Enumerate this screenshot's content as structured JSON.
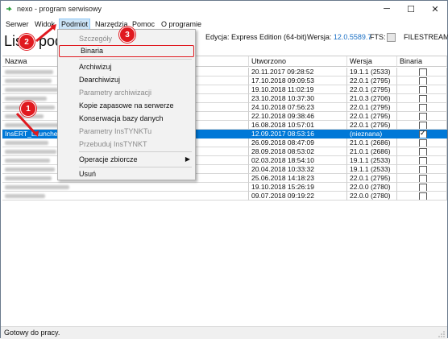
{
  "window": {
    "title": "nexo - program serwisowy",
    "controls": {
      "minimize": "─",
      "maximize": "☐",
      "close": "✕"
    }
  },
  "menu": [
    "Serwer",
    "Widok",
    "Podmiot",
    "Narzędzia",
    "Pomoc",
    "O programie"
  ],
  "heading": "Lista podmiotów",
  "info": {
    "edition_label": "Edycja:",
    "edition_value": "Express Edition (64-bit)",
    "version_label": "Wersja:",
    "version_value": "12.0.5589.7",
    "fts_label": "FTS:",
    "filestream_label": "FILESTREAM:"
  },
  "grid": {
    "columns": [
      "Nazwa",
      "Utworzono",
      "Wersja",
      "Binaria"
    ],
    "rows": [
      {
        "name": "",
        "created": "20.11.2017 09:28:52",
        "version": "19.1.1 (2533)",
        "binaria": false
      },
      {
        "name": "",
        "created": "17.10.2018 09:09:53",
        "version": "22.0.1 (2795)",
        "binaria": false
      },
      {
        "name": "",
        "created": "19.10.2018 11:02:19",
        "version": "22.0.1 (2795)",
        "binaria": false
      },
      {
        "name": "",
        "created": "23.10.2018 10:37:30",
        "version": "21.0.3 (2706)",
        "binaria": false
      },
      {
        "name": "",
        "created": "24.10.2018 07:56:23",
        "version": "22.0.1 (2795)",
        "binaria": false
      },
      {
        "name": "",
        "created": "22.10.2018 09:38:46",
        "version": "22.0.1 (2795)",
        "binaria": false
      },
      {
        "name": "",
        "created": "16.08.2018 10:57:01",
        "version": "22.0.1 (2795)",
        "binaria": false
      },
      {
        "name": "InsERT_Launcher",
        "created": "12.09.2017 08:53:16",
        "version": "(nieznana)",
        "binaria": true,
        "selected": true
      },
      {
        "name": "",
        "created": "26.09.2018 08:47:09",
        "version": "21.0.1 (2686)",
        "binaria": false
      },
      {
        "name": "",
        "created": "28.09.2018 08:53:02",
        "version": "21.0.1 (2686)",
        "binaria": false
      },
      {
        "name": "",
        "created": "02.03.2018 18:54:10",
        "version": "19.1.1 (2533)",
        "binaria": false
      },
      {
        "name": "",
        "created": "20.04.2018 10:33:32",
        "version": "19.1.1 (2533)",
        "binaria": false
      },
      {
        "name": "",
        "created": "25.06.2018 14:18:23",
        "version": "22.0.1 (2795)",
        "binaria": false
      },
      {
        "name": "",
        "created": "19.10.2018 15:26:19",
        "version": "22.0.0 (2780)",
        "binaria": false
      },
      {
        "name": "",
        "created": "09.07.2018 09:19:22",
        "version": "22.0.0 (2780)",
        "binaria": false
      }
    ]
  },
  "dropdown": {
    "items": [
      {
        "label": "Szczegóły",
        "disabled": true
      },
      {
        "label": "Binaria",
        "disabled": false,
        "highlighted": true
      },
      {
        "label": "Archiwizuj",
        "disabled": false
      },
      {
        "label": "Dearchiwizuj",
        "disabled": false
      },
      {
        "label": "Parametry archiwizacji",
        "disabled": true
      },
      {
        "label": "Kopie zapasowe na serwerze",
        "disabled": false
      },
      {
        "label": "Konserwacja bazy danych",
        "disabled": false
      },
      {
        "label": "Parametry InsTYNKTu",
        "disabled": true
      },
      {
        "label": "Przebuduj InsTYNKT",
        "disabled": true
      },
      {
        "label": "Operacje zbiorcze",
        "disabled": false,
        "submenu": true
      },
      {
        "label": "Usuń",
        "disabled": false
      }
    ]
  },
  "annotations": [
    "1",
    "2",
    "3"
  ],
  "status": "Gotowy do pracy.",
  "colors": {
    "selection": "#0078d7",
    "annotation": "#e0191f",
    "accent_text": "#1a6fc4"
  }
}
